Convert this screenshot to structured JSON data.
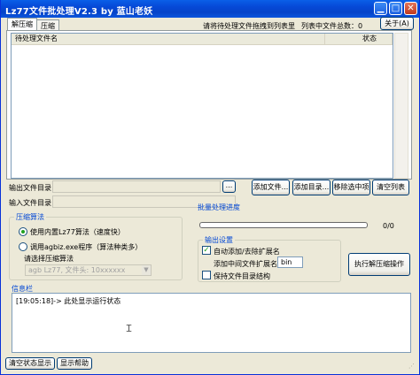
{
  "window": {
    "title": "Lz77文件批处理V2.3 by 蓝山老妖"
  },
  "tabs": [
    "解压缩",
    "压缩"
  ],
  "hint": "请将待处理文件拖拽到列表里",
  "count_label": "列表中文件总数：0",
  "about_button": "关于(A)",
  "list_columns": [
    "待处理文件名",
    "状态"
  ],
  "output_dir": {
    "label": "输出文件目录",
    "value": "",
    "browse": "..."
  },
  "input_dir": {
    "label": "输入文件目录",
    "value": ""
  },
  "buttons": {
    "add_file": "添加文件...",
    "add_dir": "添加目录...",
    "remove": "移除选中项",
    "clear": "清空列表"
  },
  "compress": {
    "title": "压缩算法",
    "builtin": "使用内置Lz77算法（速度快）",
    "external": "调用agbiz.exe程序（算法种类多）",
    "choose": "请选择压缩算法",
    "select_value": "agb Lz77, 文件头: 10xxxxxx"
  },
  "progress": {
    "title": "批量处理进度",
    "text": "0/0",
    "percent": 0
  },
  "output_settings": {
    "title": "输出设置",
    "auto_ext": "自动添加/去除扩展名",
    "add_mid_ext": "添加中间文件扩展名",
    "ext_value": "bin",
    "keep_structure": "保持文件目录结构"
  },
  "run_button": "执行解压缩操作",
  "info": {
    "title": "信息栏",
    "line": "[19:05:18]-> 此处显示运行状态"
  },
  "bottom": {
    "clear_status": "清空状态显示",
    "show_help": "显示帮助"
  },
  "colors": {
    "title_bar": "#0A5FE8",
    "group_title": "#0046D5",
    "progress_fill": "#2FBA2F"
  }
}
